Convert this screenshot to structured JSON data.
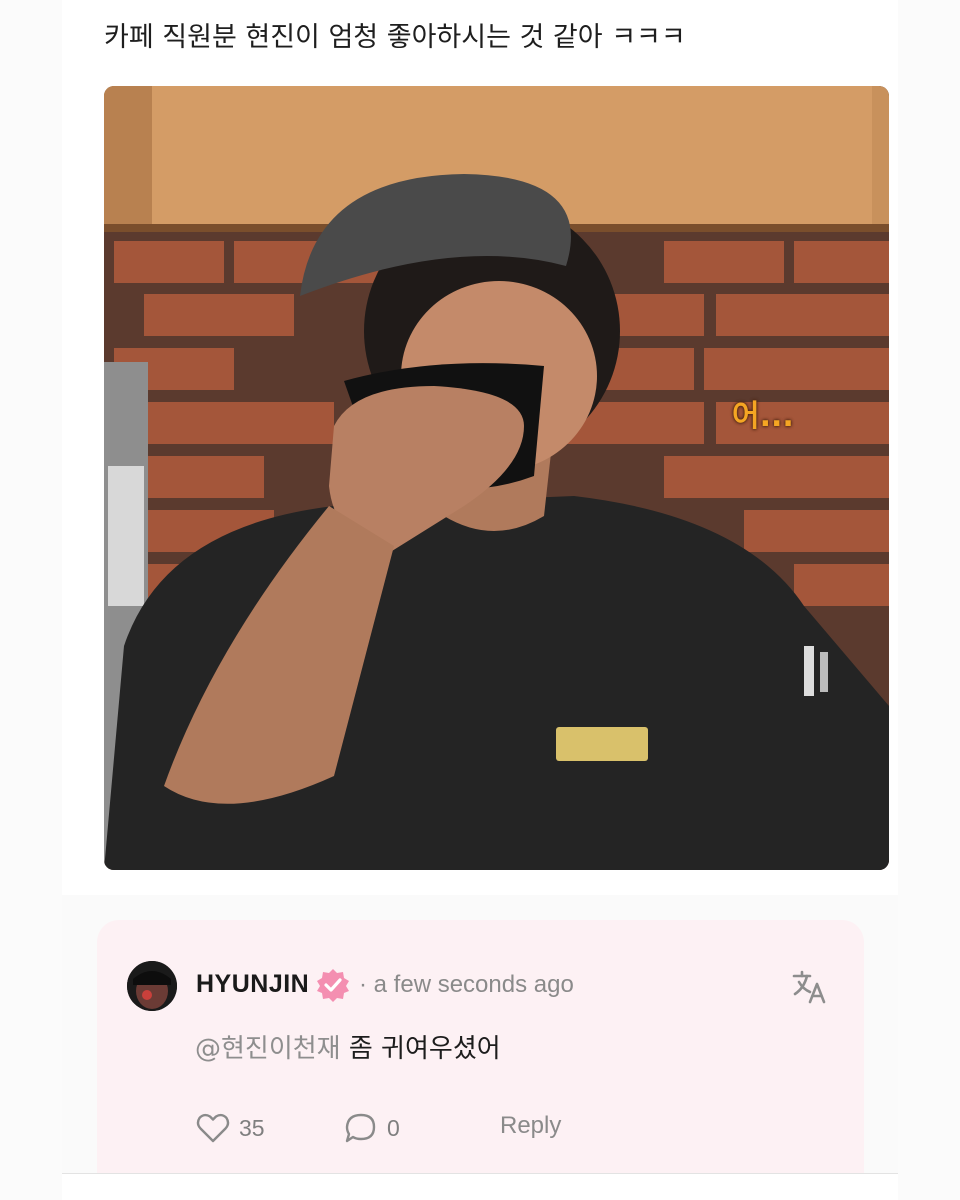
{
  "post": {
    "text": "카페 직원분 현진이 엄청 좋아하시는 것 같아 ㅋㅋㅋ",
    "image_caption": "어..."
  },
  "comment": {
    "author": "HYUNJIN",
    "timestamp": "· a few seconds ago",
    "mention": "@현진이천재",
    "text": " 좀 귀여우셨어",
    "likes": "35",
    "replies": "0",
    "reply_label": "Reply",
    "verified_color": "#f48fb1",
    "icons": [
      "heart-icon",
      "speech-bubble-icon",
      "translate-icon",
      "verified-badge-icon"
    ]
  },
  "colors": {
    "card_background": "#fdf1f4",
    "muted_text": "#8a8a8a",
    "caption_orange": "#f5a623"
  }
}
